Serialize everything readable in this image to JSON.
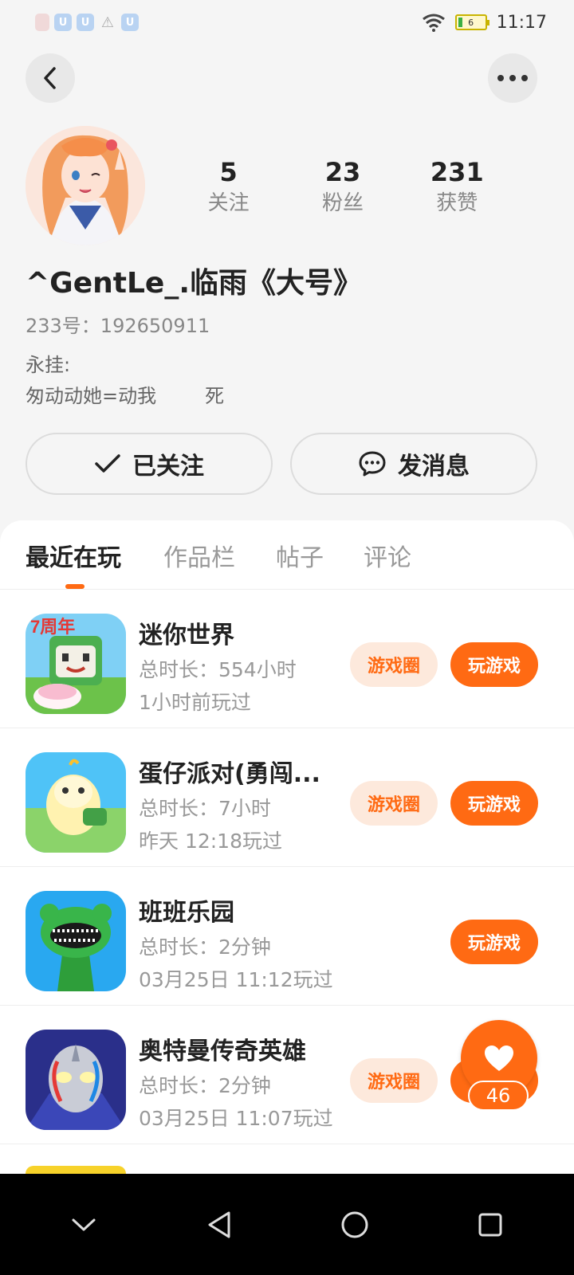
{
  "status_bar": {
    "time": "11:17",
    "battery": "6",
    "notifications": [
      "notification-icon",
      "u-icon",
      "u-icon",
      "warning-icon",
      "u-icon"
    ]
  },
  "profile": {
    "stats": [
      {
        "value": "5",
        "label": "关注"
      },
      {
        "value": "23",
        "label": "粉丝"
      },
      {
        "value": "231",
        "label": "获赞"
      }
    ],
    "username": "^GentLe_.临雨《大号》",
    "id_text": "233号：192650911",
    "bio_line1": "永挂:",
    "bio_line2": "匆动动她=动我        死"
  },
  "actions": {
    "follow_label": "已关注",
    "message_label": "发消息"
  },
  "tabs": [
    {
      "label": "最近在玩",
      "active": true
    },
    {
      "label": "作品栏",
      "active": false
    },
    {
      "label": "帖子",
      "active": false
    },
    {
      "label": "评论",
      "active": false
    }
  ],
  "games": [
    {
      "name": "迷你世界",
      "total_time": "总时长：554小时",
      "last_played": "1小时前玩过",
      "circle_label": "游戏圈",
      "play_label": "玩游戏",
      "icon": "mini-world-icon"
    },
    {
      "name": "蛋仔派对(勇闯...",
      "total_time": "总时长：7小时",
      "last_played": "昨天 12:18玩过",
      "circle_label": "游戏圈",
      "play_label": "玩游戏",
      "icon": "eggy-party-icon"
    },
    {
      "name": "班班乐园",
      "total_time": "总时长：2分钟",
      "last_played": "03月25日 11:12玩过",
      "circle_label": "",
      "play_label": "玩游戏",
      "icon": "banban-icon"
    },
    {
      "name": "奥特曼传奇英雄",
      "total_time": "总时长：2分钟",
      "last_played": "03月25日 11:07玩过",
      "circle_label": "游戏圈",
      "play_label": "",
      "icon": "ultraman-icon"
    }
  ],
  "like_float": {
    "count": "46"
  },
  "colors": {
    "accent": "#ff6a13",
    "accent_light": "#fde9dc"
  }
}
